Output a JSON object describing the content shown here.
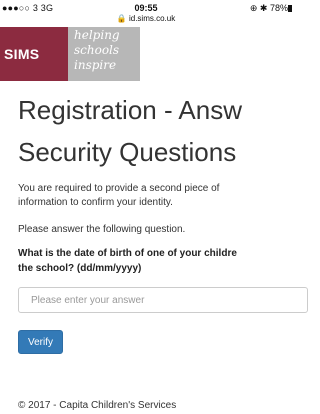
{
  "status_bar": {
    "carrier": "●●●○○ 3  3G",
    "time": "09:55",
    "url": "🔒 id.sims.co.uk",
    "right": "⊕ ✱ 78%"
  },
  "logo": {
    "brand": "SIMS",
    "tagline": [
      "helping",
      "schools",
      "inspire"
    ]
  },
  "page": {
    "title_line1": "Registration - Answ",
    "title_line2": "Security Questions",
    "intro_line1": "You are required to provide a second piece of",
    "intro_line2": "information to confirm your identity.",
    "instruction": "Please answer the following question.",
    "question_line1": "What is the date of birth of one of your childre",
    "question_line2": "the school? (dd/mm/yyyy)"
  },
  "form": {
    "answer_placeholder": "Please enter your answer",
    "answer_value": "",
    "verify_label": "Verify"
  },
  "footer": {
    "copyright": "© 2017 - Capita Children's Services"
  },
  "colors": {
    "sims_brand": "#8c2b40",
    "tagline_bg": "#b7b7b7",
    "button_primary": "#337ab7"
  }
}
